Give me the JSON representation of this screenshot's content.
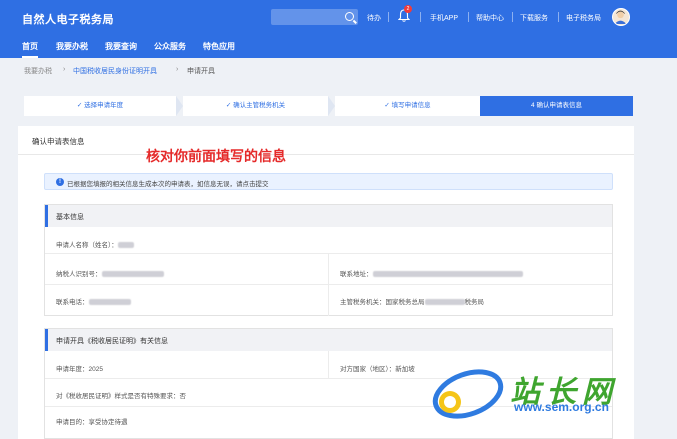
{
  "header": {
    "title": "自然人电子税务局",
    "links": [
      "待办",
      "手机APP",
      "帮助中心",
      "下载服务",
      "电子税务局"
    ],
    "badge_count": "2",
    "nav": [
      "首页",
      "我要办税",
      "我要查询",
      "公众服务",
      "特色应用"
    ]
  },
  "breadcrumb": [
    "我要办税",
    "中国税收居民身份证明开具",
    "申请开具"
  ],
  "steps": [
    "✓ 选择申请年度",
    "✓ 确认主管税务机关",
    "✓ 填写申请信息",
    "4  确认申请表信息"
  ],
  "card": {
    "title": "确认申请表信息",
    "annotation": "核对你前面填写的信息",
    "notice": "已根据您填报的相关信息生成本次的申请表，如信息无误，请点击提交"
  },
  "basic": {
    "title": "基本信息",
    "name_label": "申请人名称（姓名）：",
    "taxid_label": "纳税人识别号：",
    "address_label": "联系地址：",
    "phone_label": "联系电话：",
    "authority_label": "主管税务机关：",
    "authority_prefix": "国家税务总局",
    "authority_suffix": "税务局"
  },
  "apply": {
    "title": "申请开具《税收居民证明》有关信息",
    "year_label": "申请年度：",
    "year_value": "2025",
    "country_label": "对方国家（地区）：",
    "country_value": "新加坡",
    "format_label": "对《税收居民证明》样式是否有特殊要求：",
    "format_value": "否",
    "purpose_label": "申请目的：",
    "purpose_value": "享受协定待遇"
  },
  "watermark": {
    "text": "站长网",
    "url": "www.sem.org.cn"
  },
  "colors": {
    "primary": "#2f6fe3",
    "annotation": "#e52a2a"
  }
}
